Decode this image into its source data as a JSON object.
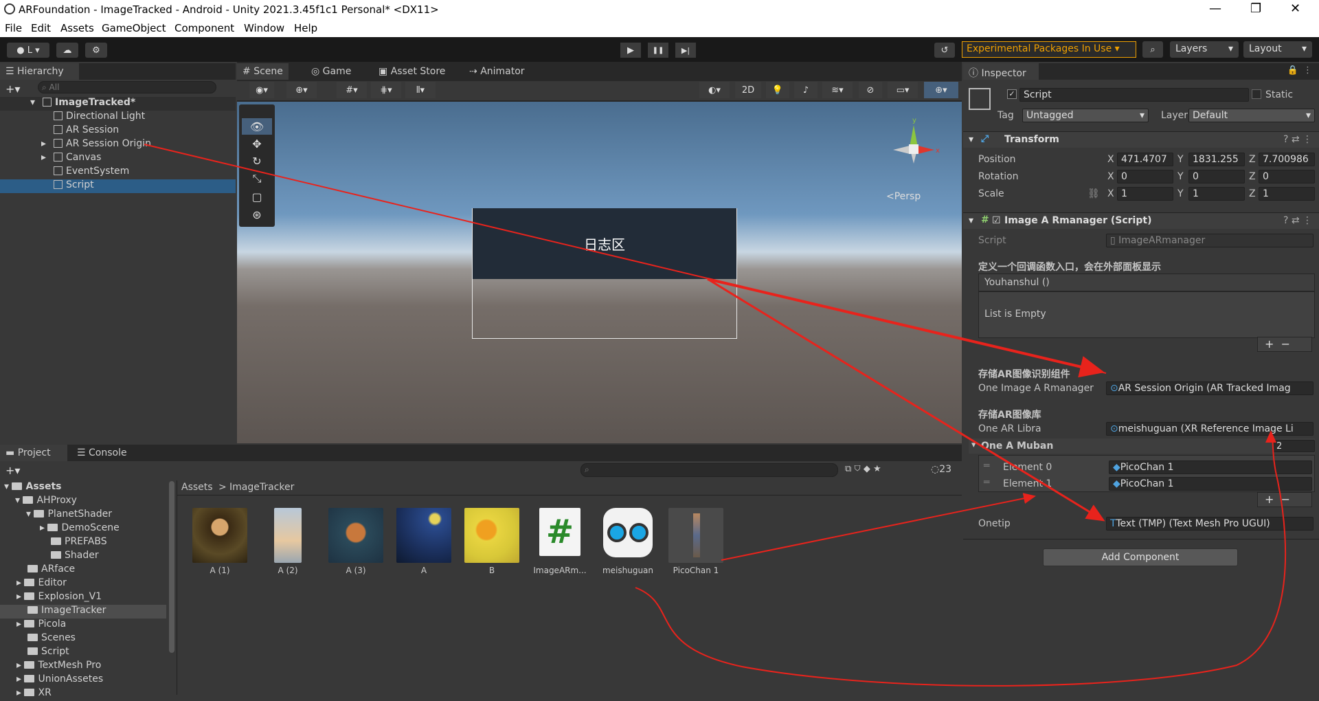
{
  "window": {
    "title": "ARFoundation - ImageTracked - Android - Unity 2021.3.45f1c1 Personal* <DX11>",
    "minimize": "—",
    "maximize": "❐",
    "close": "✕"
  },
  "menu": [
    "File",
    "Edit",
    "Assets",
    "GameObject",
    "Component",
    "Window",
    "Help"
  ],
  "toolbar": {
    "account": "L",
    "experimental": "Experimental Packages In Use",
    "layers": "Layers",
    "layout": "Layout",
    "play": "▶",
    "pause": "❚❚",
    "step": "▶|"
  },
  "hierarchy": {
    "tab": "Hierarchy",
    "search_placeholder": "All",
    "scene": "ImageTracked*",
    "items": [
      "Directional Light",
      "AR Session",
      "AR Session Origin",
      "Canvas",
      "EventSystem",
      "Script"
    ]
  },
  "scene_tabs": [
    "Scene",
    "Game",
    "Asset Store",
    "Animator"
  ],
  "scene": {
    "canvas_text": "日志区",
    "persp": "<Persp",
    "btn_2d": "2D",
    "axis_y": "y",
    "axis_x": "x"
  },
  "project": {
    "tabs": [
      "Project",
      "Console"
    ],
    "count": "23",
    "breadcrumb": [
      "Assets",
      "ImageTracker"
    ],
    "tree": [
      "Assets",
      "AHProxy",
      "PlanetShader",
      "DemoScene",
      "PREFABS",
      "Shader",
      "ARface",
      "Editor",
      "Explosion_V1",
      "ImageTracker",
      "Picola",
      "Scenes",
      "Script",
      "TextMesh Pro",
      "UnionAssetes",
      "XR"
    ],
    "assets": [
      "A (1)",
      "A (2)",
      "A (3)",
      "A",
      "B",
      "ImageARm...",
      "meishuguan",
      "PicoChan 1"
    ],
    "script_glyph": "#"
  },
  "inspector": {
    "tab": "Inspector",
    "object_name": "Script",
    "static_label": "Static",
    "tag_label": "Tag",
    "tag_value": "Untagged",
    "layer_label": "Layer",
    "layer_value": "Default",
    "transform": {
      "title": "Transform",
      "position_label": "Position",
      "rotation_label": "Rotation",
      "scale_label": "Scale",
      "axes": [
        "X",
        "Y",
        "Z"
      ],
      "position": [
        "471.4707",
        "1831.255",
        "7.700986"
      ],
      "rotation": [
        "0",
        "0",
        "0"
      ],
      "scale": [
        "1",
        "1",
        "1"
      ]
    },
    "component": {
      "title": "Image A Rmanager (Script)",
      "script_label": "Script",
      "script_value": "ImageARmanager",
      "header1": "定义一个回调函数入口，会在外部面板显示",
      "event_name": "Youhanshul ()",
      "event_empty": "List is Empty",
      "header2": "存储AR图像识别组件",
      "field1_label": "One Image A Rmanager",
      "field1_value": "AR Session Origin (AR Tracked Imag",
      "header3": "存储AR图像库",
      "field2_label": "One AR Libra",
      "field2_value": "meishuguan (XR Reference Image Li",
      "list_label": "One A Muban",
      "list_size": "2",
      "elements": [
        {
          "label": "Element 0",
          "value": "PicoChan 1"
        },
        {
          "label": "Element 1",
          "value": "PicoChan 1"
        }
      ],
      "onetip_label": "Onetip",
      "onetip_value": "Text (TMP) (Text Mesh Pro UGUI)"
    },
    "add_component": "Add Component"
  },
  "colors": {
    "selection": "#2c5d87",
    "annotation": "#e8231c",
    "warning": "#f0a000"
  }
}
